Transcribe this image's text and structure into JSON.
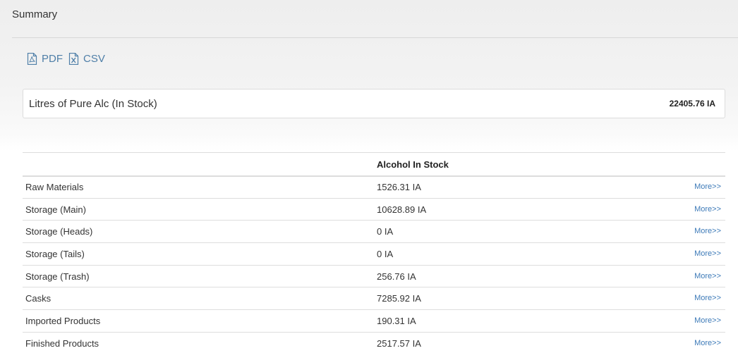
{
  "panel": {
    "title": "Summary"
  },
  "exports": {
    "pdf_label": "PDF",
    "csv_label": "CSV"
  },
  "summary": {
    "label": "Litres of Pure Alc (In Stock)",
    "value": "22405.76 IA"
  },
  "table": {
    "headers": [
      "",
      "Alcohol In Stock",
      ""
    ],
    "more_label": "More>>",
    "rows": [
      {
        "name": "Raw Materials",
        "value": "1526.31 IA"
      },
      {
        "name": "Storage (Main)",
        "value": "10628.89 IA"
      },
      {
        "name": "Storage (Heads)",
        "value": "0 IA"
      },
      {
        "name": "Storage (Tails)",
        "value": "0 IA"
      },
      {
        "name": "Storage (Trash)",
        "value": "256.76 IA"
      },
      {
        "name": "Casks",
        "value": "7285.92 IA"
      },
      {
        "name": "Imported Products",
        "value": "190.31 IA"
      },
      {
        "name": "Finished Products",
        "value": "2517.57 IA"
      }
    ]
  },
  "colors": {
    "link": "#4f7fa8",
    "more_link": "#3d7ab8",
    "border": "#dddddd"
  }
}
